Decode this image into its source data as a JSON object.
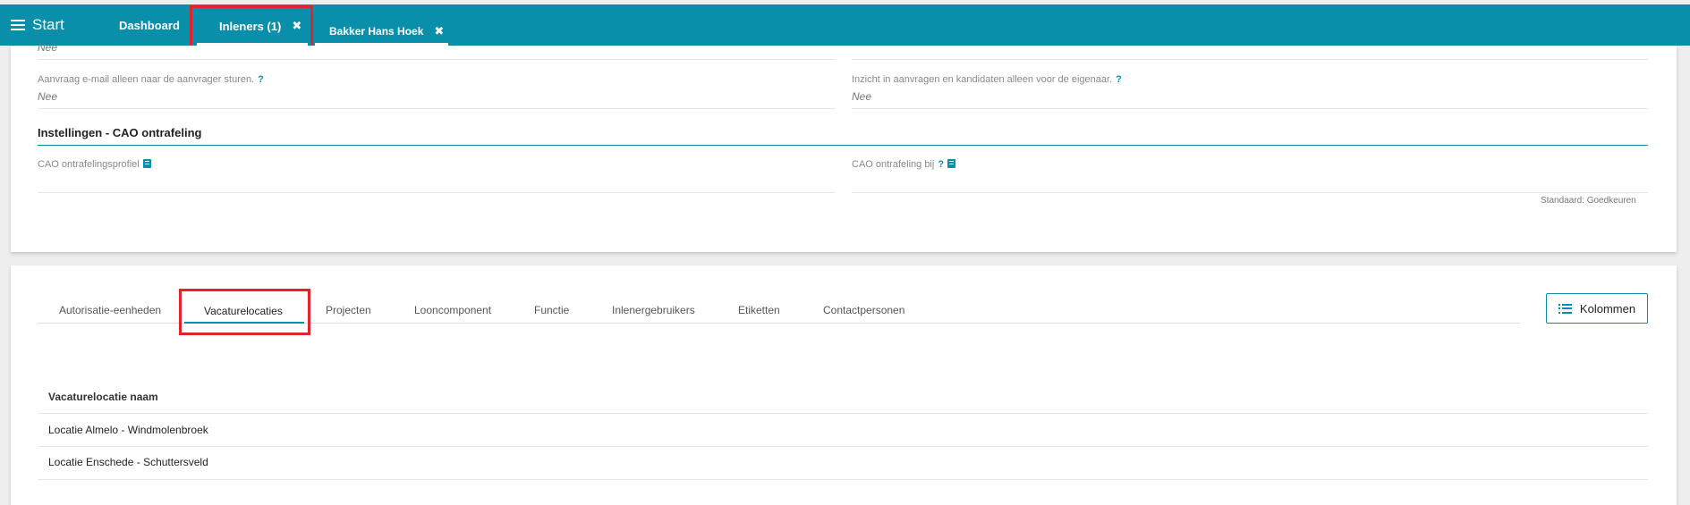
{
  "topbar": {
    "start_label": "Start",
    "tabs": [
      {
        "label": "Dashboard",
        "closable": false
      },
      {
        "label": "Inleners (1)",
        "closable": true
      },
      {
        "label": "Bakker Hans Hoek",
        "closable": true
      }
    ],
    "close_glyph": "✖",
    "accent_color": "#0a8fab",
    "highlight_color": "#e0242b"
  },
  "settings": {
    "top_partial_value": "Nee",
    "fields": [
      {
        "label": "Aanvraag e-mail alleen naar de aanvrager sturen.",
        "help": "?",
        "value": "Nee"
      },
      {
        "label": "Inzicht in aanvragen en kandidaten alleen voor de eigenaar.",
        "help": "?",
        "value": "Nee"
      }
    ],
    "cao_section_title": "Instellingen - CAO ontrafeling",
    "cao_fields": [
      {
        "label": "CAO ontrafelingsprofiel",
        "icon": "book-icon"
      },
      {
        "label": "CAO ontrafeling bij",
        "help": "?",
        "icon": "book-icon"
      }
    ],
    "standaard_note": "Standaard: Goedkeuren"
  },
  "detail_tabs": [
    {
      "label": "Autorisatie-eenheden",
      "active": false
    },
    {
      "label": "Vacaturelocaties",
      "active": true
    },
    {
      "label": "Projecten",
      "active": false
    },
    {
      "label": "Looncomponent",
      "active": false
    },
    {
      "label": "Functie",
      "active": false
    },
    {
      "label": "Inlenergebruikers",
      "active": false
    },
    {
      "label": "Etiketten",
      "active": false
    },
    {
      "label": "Contactpersonen",
      "active": false
    }
  ],
  "kolommen_button": {
    "label": "Kolommen",
    "icon": "list-icon"
  },
  "table": {
    "header": "Vacaturelocatie naam",
    "rows": [
      "Locatie Almelo - Windmolenbroek",
      "Locatie Enschede - Schuttersveld"
    ]
  }
}
